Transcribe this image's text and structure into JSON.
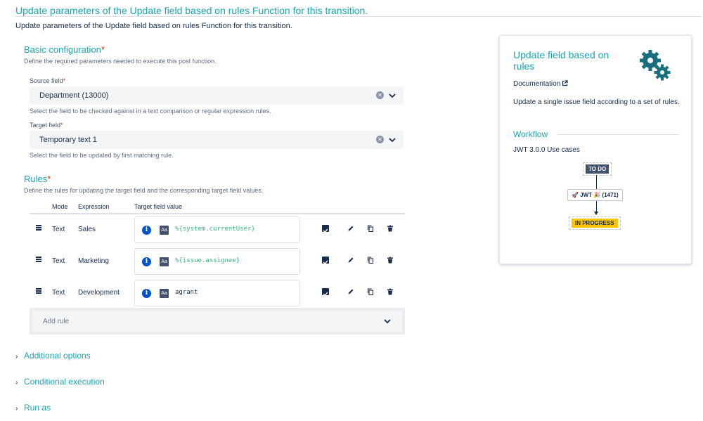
{
  "page": {
    "title": "Update parameters of the Update field based on rules Function for this transition.",
    "description": "Update parameters of the Update field based on rules Function for this transition."
  },
  "basic_configuration": {
    "title": "Basic configuration",
    "required_mark": "*",
    "description": "Define the required parameters needed to execute this post function.",
    "source_field": {
      "label": "Source field",
      "required_mark": "*",
      "value": "Department (13000)",
      "help": "Select the field to be checked against in a text comparison or regular expression rules."
    },
    "target_field": {
      "label": "Target field",
      "required_mark": "*",
      "value": "Temporary text 1",
      "help": "Select the field to be updated by first matching rule."
    }
  },
  "rules": {
    "title": "Rules",
    "required_mark": "*",
    "description": "Define the rules for updating the target field and the corresponding target field values.",
    "columns": [
      "Mode",
      "Expression",
      "Target field value"
    ],
    "rows": [
      {
        "mode": "Text",
        "expression": "Sales",
        "value": "%{system.currentUser}",
        "value_is_expression": true,
        "checked": true
      },
      {
        "mode": "Text",
        "expression": "Marketing",
        "value": "%{issue.assignee}",
        "value_is_expression": true,
        "checked": true
      },
      {
        "mode": "Text",
        "expression": "Development",
        "value": "agrant",
        "value_is_expression": false,
        "checked": true
      }
    ],
    "add_rule_label": "Add rule"
  },
  "collapsibles": [
    "Additional options",
    "Conditional execution",
    "Run as"
  ],
  "panel": {
    "title": "Update field based on rules",
    "documentation_label": "Documentation",
    "description": "Update a single issue field according to a set of rules.",
    "workflow_title": "Workflow",
    "workflow_caption": "JWT 3.0.0 Use cases",
    "workflow": {
      "from_status": "TO DO",
      "transition": "JWT",
      "transition_id": "(1471)",
      "to_status": "IN PROGRESS"
    }
  },
  "colors": {
    "accent": "#1aa6b7",
    "required": "#de350b",
    "expression": "#36b37e",
    "todo_lozenge": "#42526e",
    "in_progress_lozenge": "#ffc400"
  },
  "icons": [
    "clear-icon",
    "chevron-down-icon",
    "drag-handle-icon",
    "info-icon",
    "text-format-icon",
    "checkbox-icon",
    "edit-icon",
    "copy-icon",
    "delete-icon",
    "chevron-right-icon",
    "gears-icon",
    "external-link-icon",
    "rocket-icon",
    "party-icon"
  ]
}
